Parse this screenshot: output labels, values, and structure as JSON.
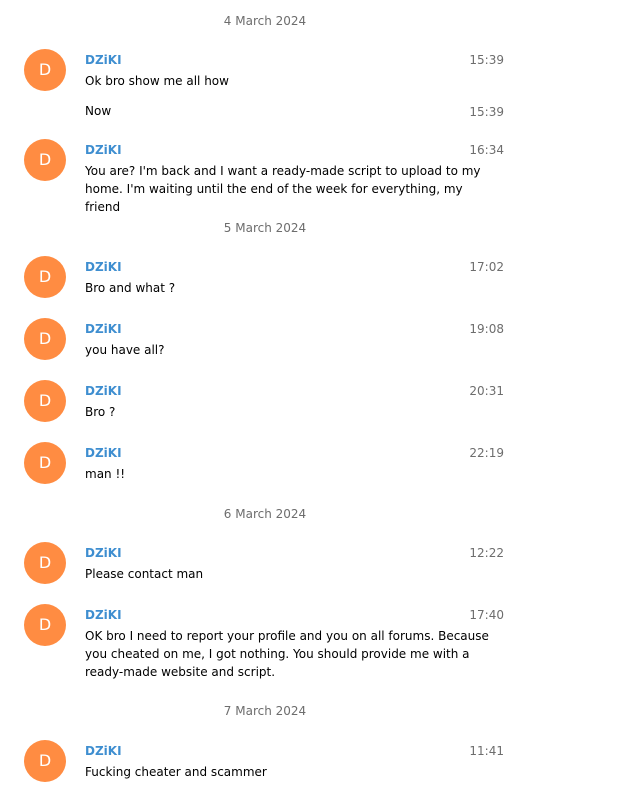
{
  "dates": [
    "4 March 2024",
    "5 March 2024",
    "6 March 2024",
    "7 March 2024"
  ],
  "avatar_letter": "D",
  "avatar_color": "#ff8c42",
  "sender_color": "#3e8ed0",
  "messages": [
    {
      "sender": "DZiKI",
      "time": "15:39",
      "text": "Ok bro show me all how"
    },
    {
      "time": "15:39",
      "text": "Now"
    },
    {
      "sender": "DZiKI",
      "time": "16:34",
      "text": "You are? I'm back and I want a ready-made script to upload to my home. I'm waiting until the end of the week for everything, my friend"
    },
    {
      "sender": "DZiKI",
      "time": "17:02",
      "text": "Bro and what ?"
    },
    {
      "sender": "DZiKI",
      "time": "19:08",
      "text": "you have all?"
    },
    {
      "sender": "DZiKI",
      "time": "20:31",
      "text": "Bro ?"
    },
    {
      "sender": "DZiKI",
      "time": "22:19",
      "text": "man !!"
    },
    {
      "sender": "DZiKI",
      "time": "12:22",
      "text": "Please contact man"
    },
    {
      "sender": "DZiKI",
      "time": "17:40",
      "text": "OK bro I need to report your profile and you on all forums. Because you cheated on me, I got nothing. You should provide me with a ready-made website and script."
    },
    {
      "sender": "DZiKI",
      "time": "11:41",
      "text": "Fucking cheater and scammer"
    }
  ]
}
